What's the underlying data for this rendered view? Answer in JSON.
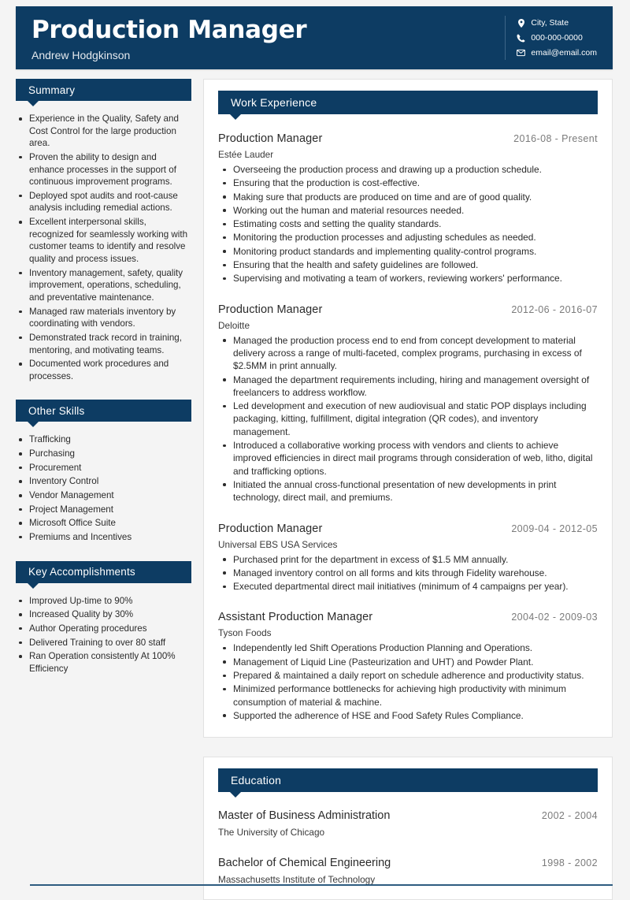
{
  "header": {
    "title": "Production Manager",
    "name": "Andrew Hodgkinson",
    "contacts": [
      {
        "icon": "location-pin-icon",
        "text": "City, State"
      },
      {
        "icon": "phone-icon",
        "text": "000-000-0000"
      },
      {
        "icon": "envelope-icon",
        "text": "email@email.com"
      }
    ]
  },
  "colors": {
    "navy": "#0d3c63",
    "page_background": "#f4f4f4",
    "card_background": "#ffffff",
    "date_text": "#7b7b7b"
  },
  "sidebar": {
    "summary": {
      "heading": "Summary",
      "items": [
        "Experience in the Quality, Safety and Cost Control for the large production area.",
        "Proven the ability to design and enhance processes in the support of continuous improvement programs.",
        "Deployed spot audits and root-cause analysis including remedial actions.",
        "Excellent interpersonal skills, recognized for seamlessly working with customer teams to identify and resolve quality and process issues.",
        "Inventory management, safety, quality improvement, operations, scheduling, and preventative maintenance.",
        "Managed raw materials inventory by coordinating with vendors.",
        "Demonstrated track record in training, mentoring, and motivating teams.",
        "Documented work procedures and processes."
      ]
    },
    "other_skills": {
      "heading": "Other Skills",
      "items": [
        "Trafficking",
        "Purchasing",
        "Procurement",
        "Inventory Control",
        "Vendor Management",
        "Project Management",
        "Microsoft Office Suite",
        "Premiums and Incentives"
      ]
    },
    "key_accomplishments": {
      "heading": "Key Accomplishments",
      "items": [
        "Improved Up-time to 90%",
        "Increased Quality by 30%",
        "Author Operating procedures",
        "Delivered Training to over 80 staff",
        "Ran Operation consistently At 100% Efficiency"
      ]
    }
  },
  "work_experience": {
    "heading": "Work Experience",
    "entries": [
      {
        "title": "Production Manager",
        "date": "2016-08 - Present",
        "organization": "Estée Lauder",
        "bullets": [
          "Overseeing the production process and drawing up a production schedule.",
          "Ensuring that the production is cost-effective.",
          "Making sure that products are produced on time and are of good quality.",
          "Working out the human and material resources needed.",
          "Estimating costs and setting the quality standards.",
          "Monitoring the production processes and adjusting schedules as needed.",
          "Monitoring product standards and implementing quality-control programs.",
          "Ensuring that the health and safety guidelines are followed.",
          "Supervising and motivating a team of workers, reviewing workers' performance."
        ]
      },
      {
        "title": "Production Manager",
        "date": "2012-06 - 2016-07",
        "organization": "Deloitte",
        "bullets": [
          "Managed the production process end to end from concept development to material delivery across a range of multi-faceted, complex programs, purchasing in excess of $2.5MM in print annually.",
          "Managed the department requirements including, hiring and management oversight of freelancers to address workflow.",
          "Led development and execution of new audiovisual and static POP displays including packaging, kitting, fulfillment, digital integration (QR codes), and inventory management.",
          "Introduced a collaborative working process with vendors and clients to achieve improved efficiencies in direct mail programs through consideration of web, litho, digital and trafficking options.",
          "Initiated the annual cross-functional presentation of new developments in print technology, direct mail, and premiums."
        ]
      },
      {
        "title": "Production Manager",
        "date": "2009-04 - 2012-05",
        "organization": "Universal EBS USA Services",
        "bullets": [
          "Purchased print for the department in excess of $1.5 MM annually.",
          "Managed inventory control on all forms and kits through Fidelity warehouse.",
          "Executed departmental direct mail initiatives (minimum of 4 campaigns per year)."
        ]
      },
      {
        "title": "Assistant Production Manager",
        "date": "2004-02 - 2009-03",
        "organization": "Tyson Foods",
        "bullets": [
          "Independently led Shift Operations Production Planning and Operations.",
          "Management of Liquid Line (Pasteurization and UHT) and Powder Plant.",
          "Prepared & maintained a daily report on schedule adherence and productivity status.",
          "Minimized performance bottlenecks for achieving high productivity with minimum consumption of material & machine.",
          "Supported the adherence of HSE and Food Safety Rules Compliance."
        ]
      }
    ]
  },
  "education": {
    "heading": "Education",
    "entries": [
      {
        "degree": "Master of Business Administration",
        "date": "2002 - 2004",
        "school": "The University of Chicago"
      },
      {
        "degree": "Bachelor of Chemical Engineering",
        "date": "1998 - 2002",
        "school": "Massachusetts Institute of Technology"
      }
    ]
  }
}
